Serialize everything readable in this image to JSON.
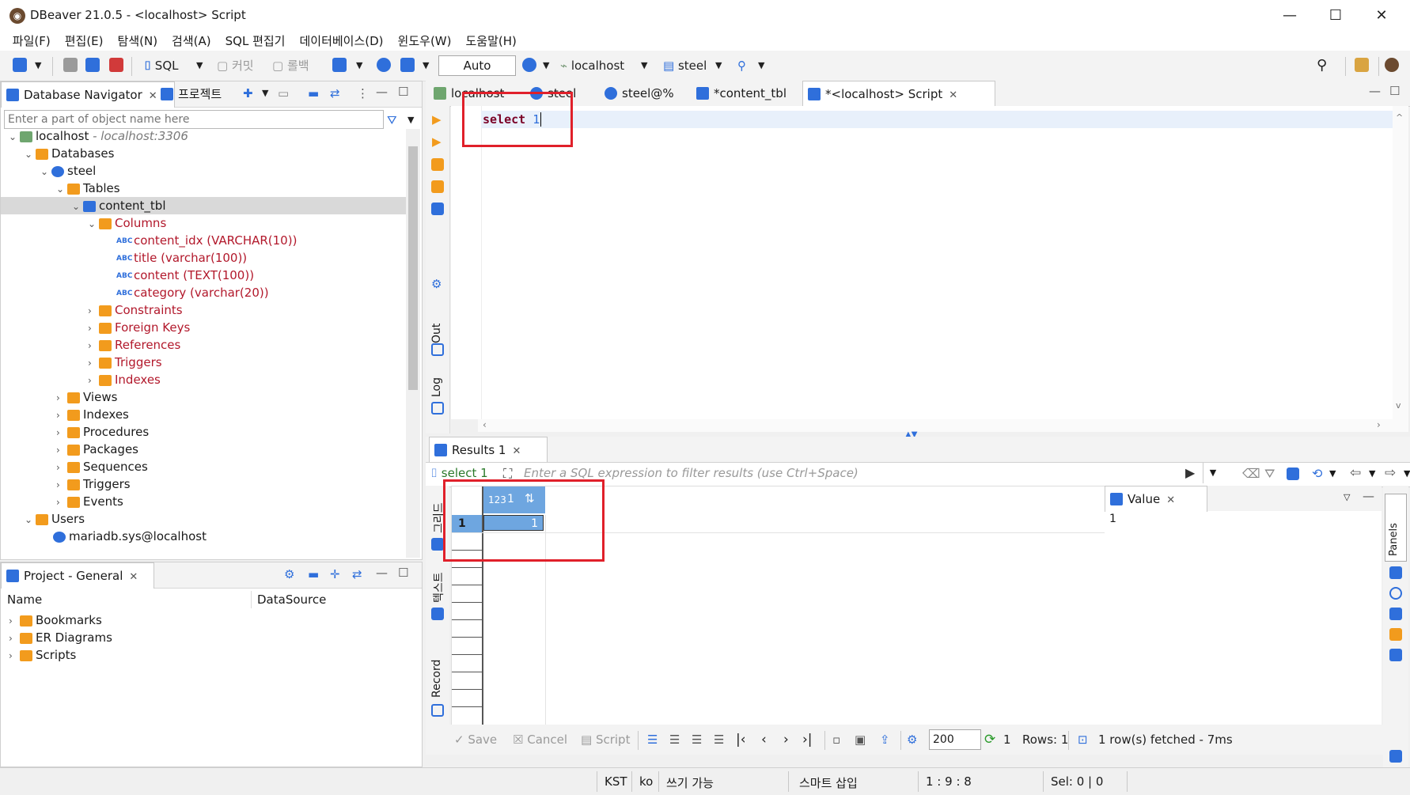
{
  "window": {
    "title": "DBeaver 21.0.5 - <localhost> Script",
    "minimize": "—",
    "maximize": "☐",
    "close": "✕"
  },
  "menu": [
    "파일(F)",
    "편집(E)",
    "탐색(N)",
    "검색(A)",
    "SQL 편집기",
    "데이터베이스(D)",
    "윈도우(W)",
    "도움말(H)"
  ],
  "toolbar": {
    "sql": "SQL",
    "commit": "커밋",
    "rollback": "롤백",
    "auto": "Auto",
    "connection": "localhost",
    "schema": "steel"
  },
  "navigator": {
    "tab_label": "Database Navigator",
    "projects_tab": "프로젝트",
    "filter_placeholder": "Enter a part of object name here",
    "tree": {
      "localhost": "localhost",
      "localhost_url": "- localhost:3306",
      "databases": "Databases",
      "steel": "steel",
      "tables": "Tables",
      "content_tbl": "content_tbl",
      "columns": "Columns",
      "col1": "content_idx (VARCHAR(10))",
      "col2": "title (varchar(100))",
      "col3": "content (TEXT(100))",
      "col4": "category (varchar(20))",
      "constraints": "Constraints",
      "foreign_keys": "Foreign Keys",
      "references": "References",
      "triggers_tbl": "Triggers",
      "indexes_tbl": "Indexes",
      "views": "Views",
      "indexes": "Indexes",
      "procedures": "Procedures",
      "packages": "Packages",
      "sequences": "Sequences",
      "triggers": "Triggers",
      "events": "Events",
      "users": "Users",
      "user1": "mariadb.sys@localhost"
    }
  },
  "project": {
    "tab_label": "Project - General",
    "col_name": "Name",
    "col_datasource": "DataSource",
    "items": [
      "Bookmarks",
      "ER Diagrams",
      "Scripts"
    ]
  },
  "editor": {
    "tabs": [
      "localhost",
      "steel",
      "steel@%",
      "*content_tbl",
      "*<localhost> Script"
    ],
    "keyword": "select",
    "number": "1",
    "side_out": "Out",
    "side_log": "Log"
  },
  "results": {
    "tab_label": "Results 1",
    "query_chip": "select 1",
    "filter_placeholder": "Enter a SQL expression to filter results (use Ctrl+Space)",
    "col_header": "1",
    "col_type": "123",
    "row_num": "1",
    "cell_value": "1",
    "side_grid": "그리드",
    "side_text": "텍스트",
    "side_record": "Record",
    "value_panel": "Value",
    "value_content": "1",
    "panels_label": "Panels",
    "save": "Save",
    "cancel": "Cancel",
    "script": "Script",
    "fetch_size": "200",
    "refresh_count": "1",
    "rows": "Rows: 1",
    "fetched": "1 row(s) fetched - 7ms"
  },
  "status": {
    "tz": "KST",
    "lang": "ko",
    "writable": "쓰기 가능",
    "insert": "스마트 삽입",
    "position": "1 : 9 : 8",
    "selection": "Sel: 0 | 0"
  },
  "colors": {
    "accent": "#2f6fdb",
    "folder": "#f29b1d",
    "column_text": "#b2182b",
    "highlight": "#e0202a",
    "selected_cell": "#6ea6e0"
  }
}
